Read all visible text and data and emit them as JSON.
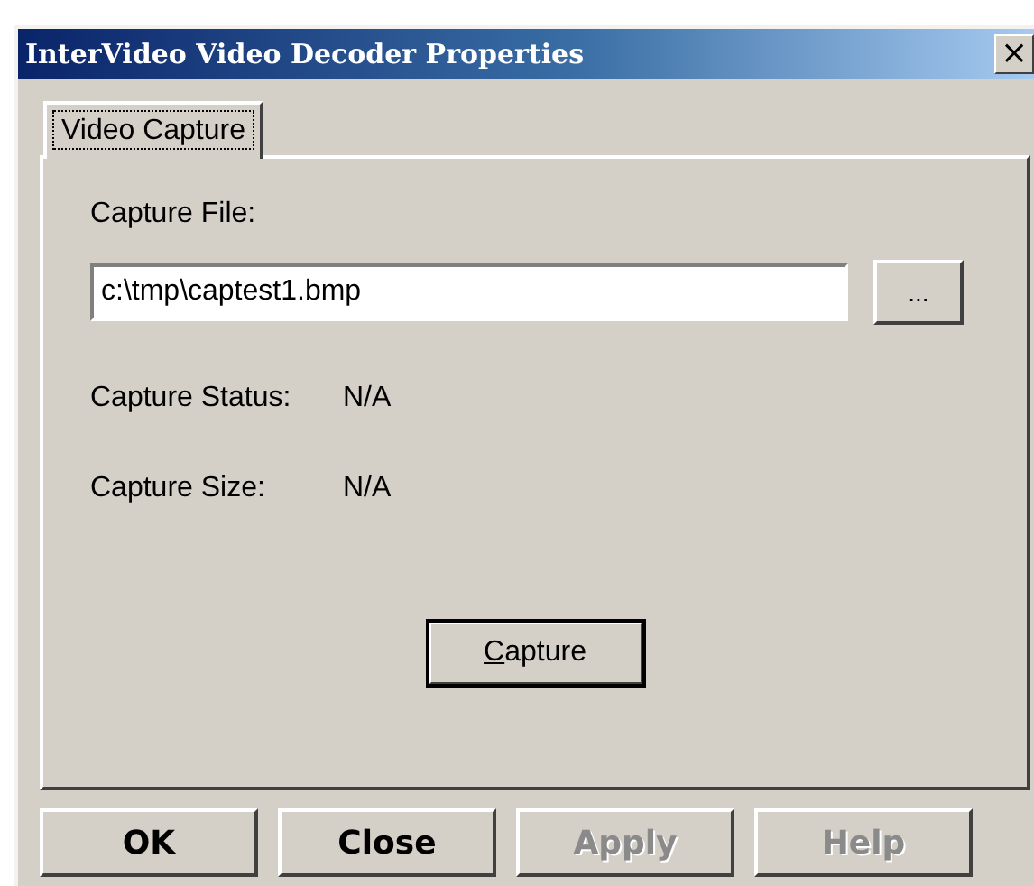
{
  "window": {
    "title": "InterVideo Video Decoder Properties",
    "close_glyph": "×"
  },
  "tabs": [
    {
      "label": "Video Capture",
      "selected": true
    }
  ],
  "capture_file": {
    "label": "Capture File:",
    "value": "c:\\tmp\\captest1.bmp",
    "browse_label": "..."
  },
  "info": [
    {
      "label": "Capture Status:",
      "value": "N/A"
    },
    {
      "label": "Capture Size:",
      "value": "N/A"
    }
  ],
  "capture_button": {
    "label": "Capture"
  },
  "buttons": [
    {
      "label": "OK",
      "disabled": false
    },
    {
      "label": "Close",
      "disabled": false
    },
    {
      "label": "Apply",
      "disabled": true
    },
    {
      "label": "Help",
      "disabled": true
    }
  ]
}
